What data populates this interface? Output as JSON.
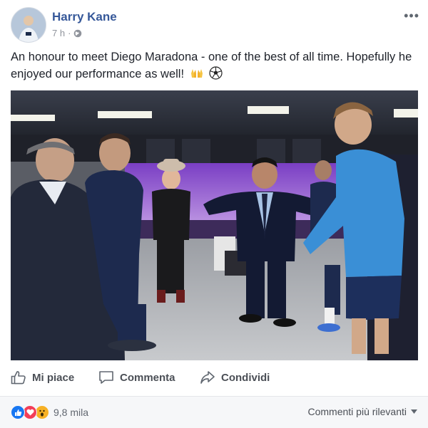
{
  "post": {
    "author": "Harry Kane",
    "time": "7 h",
    "text": "An honour to meet Diego Maradona - one of the best of all time. Hopefully he enjoyed our performance as well!",
    "emojis": [
      "raised-hands-icon",
      "soccer-ball-icon"
    ]
  },
  "actions": {
    "like": "Mi piace",
    "comment": "Commenta",
    "share": "Condividi"
  },
  "footer": {
    "reaction_icons": [
      "like-reaction-icon",
      "love-reaction-icon",
      "wow-reaction-icon"
    ],
    "reaction_count": "9,8 mila",
    "sort_label": "Commenti più rilevanti"
  },
  "colors": {
    "author_link": "#365899",
    "like_blue": "#1877f2",
    "love_red": "#f33e58",
    "wow_yellow": "#f7b125",
    "jersey_blue": "#3a8fd6"
  }
}
